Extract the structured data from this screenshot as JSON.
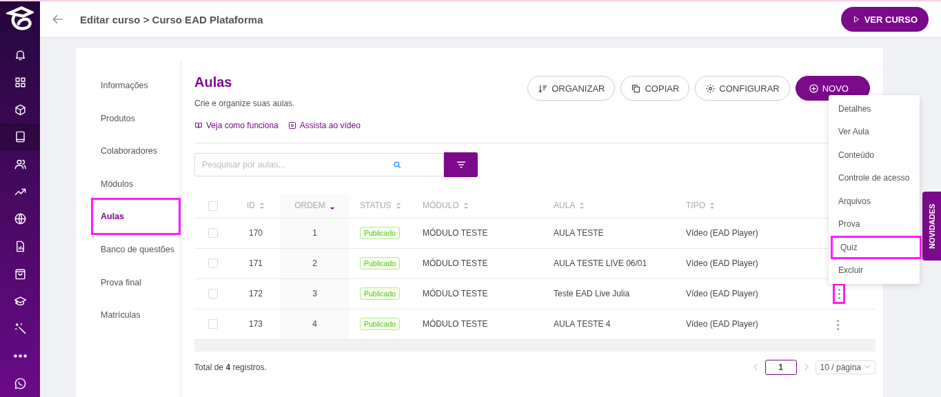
{
  "rail": {
    "items": [
      {
        "kind": "bell",
        "selected": false
      },
      {
        "kind": "grid",
        "selected": false
      },
      {
        "kind": "cube",
        "selected": false
      },
      {
        "kind": "book",
        "selected": true
      },
      {
        "kind": "users",
        "selected": false
      },
      {
        "kind": "trend",
        "selected": false
      },
      {
        "kind": "globe",
        "selected": false
      },
      {
        "kind": "report",
        "selected": false
      },
      {
        "kind": "bag",
        "selected": false
      },
      {
        "kind": "cap",
        "selected": false
      },
      {
        "kind": "wand",
        "selected": false
      },
      {
        "kind": "dots",
        "selected": false
      },
      {
        "kind": "chat",
        "selected": false
      }
    ]
  },
  "header": {
    "title": "Editar curso > Curso EAD Plataforma",
    "button": "VER CURSO"
  },
  "nav": {
    "items": [
      {
        "label": "Informações",
        "selected": false,
        "highlighted": false
      },
      {
        "label": "Produtos",
        "selected": false,
        "highlighted": false
      },
      {
        "label": "Colaboradores",
        "selected": false,
        "highlighted": false
      },
      {
        "label": "Módulos",
        "selected": false,
        "highlighted": false
      },
      {
        "label": "Aulas",
        "selected": true,
        "highlighted": true
      },
      {
        "label": "Banco de questões",
        "selected": false,
        "highlighted": false
      },
      {
        "label": "Prova final",
        "selected": false,
        "highlighted": false
      },
      {
        "label": "Matrículas",
        "selected": false,
        "highlighted": false
      }
    ]
  },
  "content": {
    "title": "Aulas",
    "subtitle": "Crie e organize suas aulas.",
    "links": [
      {
        "kind": "book",
        "label": "Veja como funciona"
      },
      {
        "kind": "play",
        "label": "Assista ao vídeo"
      }
    ],
    "actions": [
      {
        "kind": "sort",
        "label": "ORGANIZAR",
        "primary": false
      },
      {
        "kind": "copy",
        "label": "COPIAR",
        "primary": false
      },
      {
        "kind": "gear",
        "label": "CONFIGURAR",
        "primary": false
      },
      {
        "kind": "plus",
        "label": "NOVO",
        "primary": true
      }
    ],
    "search": {
      "placeholder": "Pesquisar por aulas..."
    }
  },
  "table": {
    "all_checked": false,
    "columns": [
      {
        "label": "ID",
        "sorted": false
      },
      {
        "label": "ORDEM",
        "sorted": true
      },
      {
        "label": "STATUS",
        "sorted": false
      },
      {
        "label": "MÓDULO",
        "sorted": false
      },
      {
        "label": "AULA",
        "sorted": false
      },
      {
        "label": "TIPO",
        "sorted": false
      }
    ],
    "rows": [
      {
        "checked": false,
        "id": "170",
        "order": "1",
        "status": "Publicado",
        "module": "MÓDULO TESTE",
        "lesson": "AULA TESTE",
        "type": "Vídeo (EAD Player)"
      },
      {
        "checked": false,
        "id": "171",
        "order": "2",
        "status": "Publicado",
        "module": "MÓDULO TESTE",
        "lesson": "AULA TESTE LIVE 06/01",
        "type": "Vídeo (EAD Player)"
      },
      {
        "checked": false,
        "id": "172",
        "order": "3",
        "status": "Publicado",
        "module": "MÓDULO TESTE",
        "lesson": "Teste EAD Live Julia",
        "type": "Vídeo (EAD Player)",
        "more_button": {
          "highlighted": true
        }
      },
      {
        "checked": false,
        "id": "173",
        "order": "4",
        "status": "Publicado",
        "module": "MÓDULO TESTE",
        "lesson": "AULA TESTE 4",
        "type": "Vídeo (EAD Player)",
        "more_button": {
          "highlighted": false
        }
      }
    ],
    "total": "Total de **4** registros.",
    "page": "1",
    "page_size": "10 / página"
  },
  "menu": {
    "items": [
      {
        "label": "Detalhes",
        "highlighted": false
      },
      {
        "label": "Ver Aula",
        "highlighted": false
      },
      {
        "label": "Conteúdo",
        "highlighted": false
      },
      {
        "label": "Controle de acesso",
        "highlighted": false
      },
      {
        "label": "Arquivos",
        "highlighted": false
      },
      {
        "label": "Prova",
        "highlighted": false
      },
      {
        "label": "Quiz",
        "highlighted": true
      },
      {
        "label": "Excluir",
        "highlighted": false
      }
    ]
  },
  "side_tab": "NOVIDADES"
}
